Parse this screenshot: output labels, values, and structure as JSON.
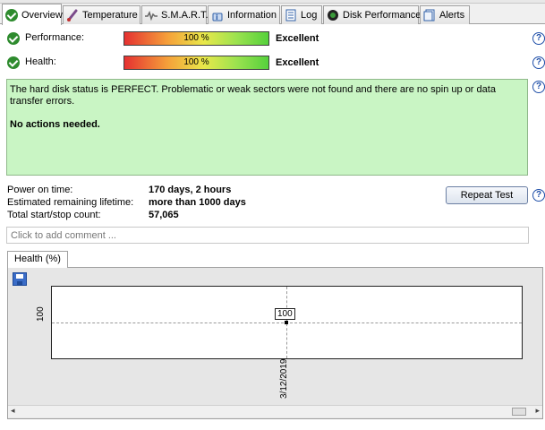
{
  "tabs": [
    {
      "label": "Overview",
      "icon": "check-circle-icon",
      "active": true
    },
    {
      "label": "Temperature",
      "icon": "thermometer-icon"
    },
    {
      "label": "S.M.A.R.T.",
      "icon": "smart-wave-icon"
    },
    {
      "label": "Information",
      "icon": "info-icon"
    },
    {
      "label": "Log",
      "icon": "log-icon"
    },
    {
      "label": "Disk Performance",
      "icon": "gauge-icon"
    },
    {
      "label": "Alerts",
      "icon": "alerts-icon"
    }
  ],
  "status": {
    "performance": {
      "label": "Performance:",
      "value_text": "100 %",
      "value": 100,
      "rating": "Excellent"
    },
    "health": {
      "label": "Health:",
      "value_text": "100 %",
      "value": 100,
      "rating": "Excellent"
    }
  },
  "status_box": {
    "message": "The hard disk status is PERFECT. Problematic or weak sectors were not found and there are no spin up or data transfer errors.",
    "action": "No actions needed."
  },
  "info": {
    "power_on_label": "Power on time:",
    "power_on_value": "170 days, 2 hours",
    "lifetime_label": "Estimated remaining lifetime:",
    "lifetime_value": "more than 1000 days",
    "startstop_label": "Total start/stop count:",
    "startstop_value": "57,065"
  },
  "buttons": {
    "repeat_test": "Repeat Test"
  },
  "comment": {
    "placeholder": "Click to add comment ..."
  },
  "chart_tab": {
    "label": "Health (%)"
  },
  "chart_data": {
    "type": "line",
    "x": [
      "3/12/2019"
    ],
    "series": [
      {
        "values": [
          100
        ]
      }
    ],
    "data_labels": [
      "100"
    ],
    "y_ticks": [
      "100"
    ],
    "x_ticks": [
      "3/12/2019"
    ],
    "grid": true
  },
  "help_glyph": "?",
  "colors": {
    "status_bg": "#c9f5c4",
    "check_green": "#2e8b2e",
    "help_blue": "#1f4fa8"
  }
}
